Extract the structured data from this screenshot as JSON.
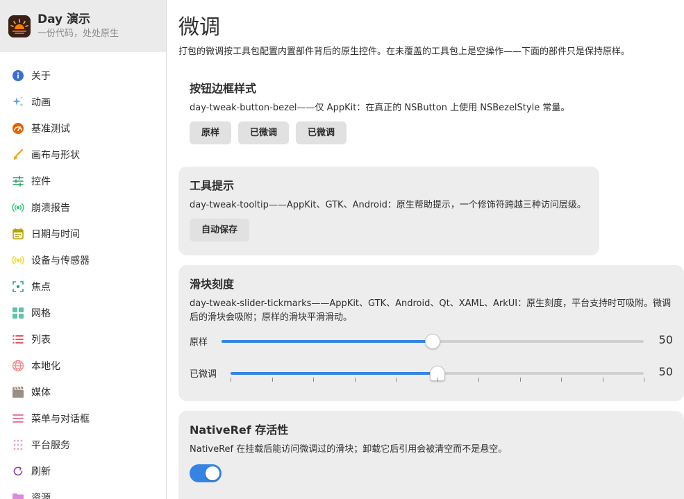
{
  "app": {
    "title": "Day 演示",
    "subtitle": "一份代码，处处原生"
  },
  "sidebar": {
    "items": [
      {
        "label": "关于",
        "icon": "info-icon",
        "color": "#3b6fd4"
      },
      {
        "label": "动画",
        "icon": "sparkle-icon",
        "color": "#62a0ea"
      },
      {
        "label": "基准测试",
        "icon": "speedometer-icon",
        "color": "#e66100"
      },
      {
        "label": "画布与形状",
        "icon": "brush-icon",
        "color": "#f5a623"
      },
      {
        "label": "控件",
        "icon": "sliders-icon",
        "color": "#26a269"
      },
      {
        "label": "崩溃报告",
        "icon": "broadcast-icon",
        "color": "#33d17a"
      },
      {
        "label": "日期与时间",
        "icon": "calendar-icon",
        "color": "#b5a100"
      },
      {
        "label": "设备与传感器",
        "icon": "sensor-icon",
        "color": "#f6d32d"
      },
      {
        "label": "焦点",
        "icon": "focus-icon",
        "color": "#2aa198"
      },
      {
        "label": "网格",
        "icon": "grid-icon",
        "color": "#5ec4a8"
      },
      {
        "label": "列表",
        "icon": "list-icon",
        "color": "#e01b24"
      },
      {
        "label": "本地化",
        "icon": "globe-icon",
        "color": "#f28b8b"
      },
      {
        "label": "媒体",
        "icon": "film-icon",
        "color": "#9a8f85"
      },
      {
        "label": "菜单与对话框",
        "icon": "menu-icon",
        "color": "#e64980"
      },
      {
        "label": "平台服务",
        "icon": "dots-grid-icon",
        "color": "#e8a0d0"
      },
      {
        "label": "刷新",
        "icon": "refresh-icon",
        "color": "#9141ac"
      },
      {
        "label": "资源",
        "icon": "folder-icon",
        "color": "#dc8add"
      }
    ]
  },
  "page": {
    "title": "微调",
    "description": "打包的微调按工具包配置内置部件背后的原生控件。在未覆盖的工具包上是空操作——下面的部件只是保持原样。"
  },
  "sections": {
    "bezel": {
      "title": "按钮边框样式",
      "description": "day-tweak-button-bezel——仅 AppKit：在真正的 NSButton 上使用 NSBezelStyle 常量。",
      "buttons": [
        "原样",
        "已微调",
        "已微调"
      ]
    },
    "tooltip": {
      "title": "工具提示",
      "description": "day-tweak-tooltip——AppKit、GTK、Android：原生帮助提示，一个修饰符跨越三种访问层级。",
      "button": "自动保存"
    },
    "slider": {
      "title": "滑块刻度",
      "description": "day-tweak-slider-tickmarks——AppKit、GTK、Android、Qt、XAML、ArkUI：原生刻度，平台支持时可吸附。微调后的滑块会吸附；原样的滑块平滑滑动。",
      "rows": [
        {
          "label": "原样",
          "value": "50",
          "fraction": 0.5
        },
        {
          "label": "已微调",
          "value": "50",
          "fraction": 0.5
        }
      ],
      "tick_count": 11
    },
    "nativeref": {
      "title": "NativeRef 存活性",
      "description": "NativeRef 在挂载后能访问微调过的滑块；卸载它后引用会被清空而不是悬空。",
      "toggle_on": true
    }
  },
  "colors": {
    "accent": "#3584e4",
    "card": "#ededed",
    "sidebar_header": "#ebebeb"
  }
}
